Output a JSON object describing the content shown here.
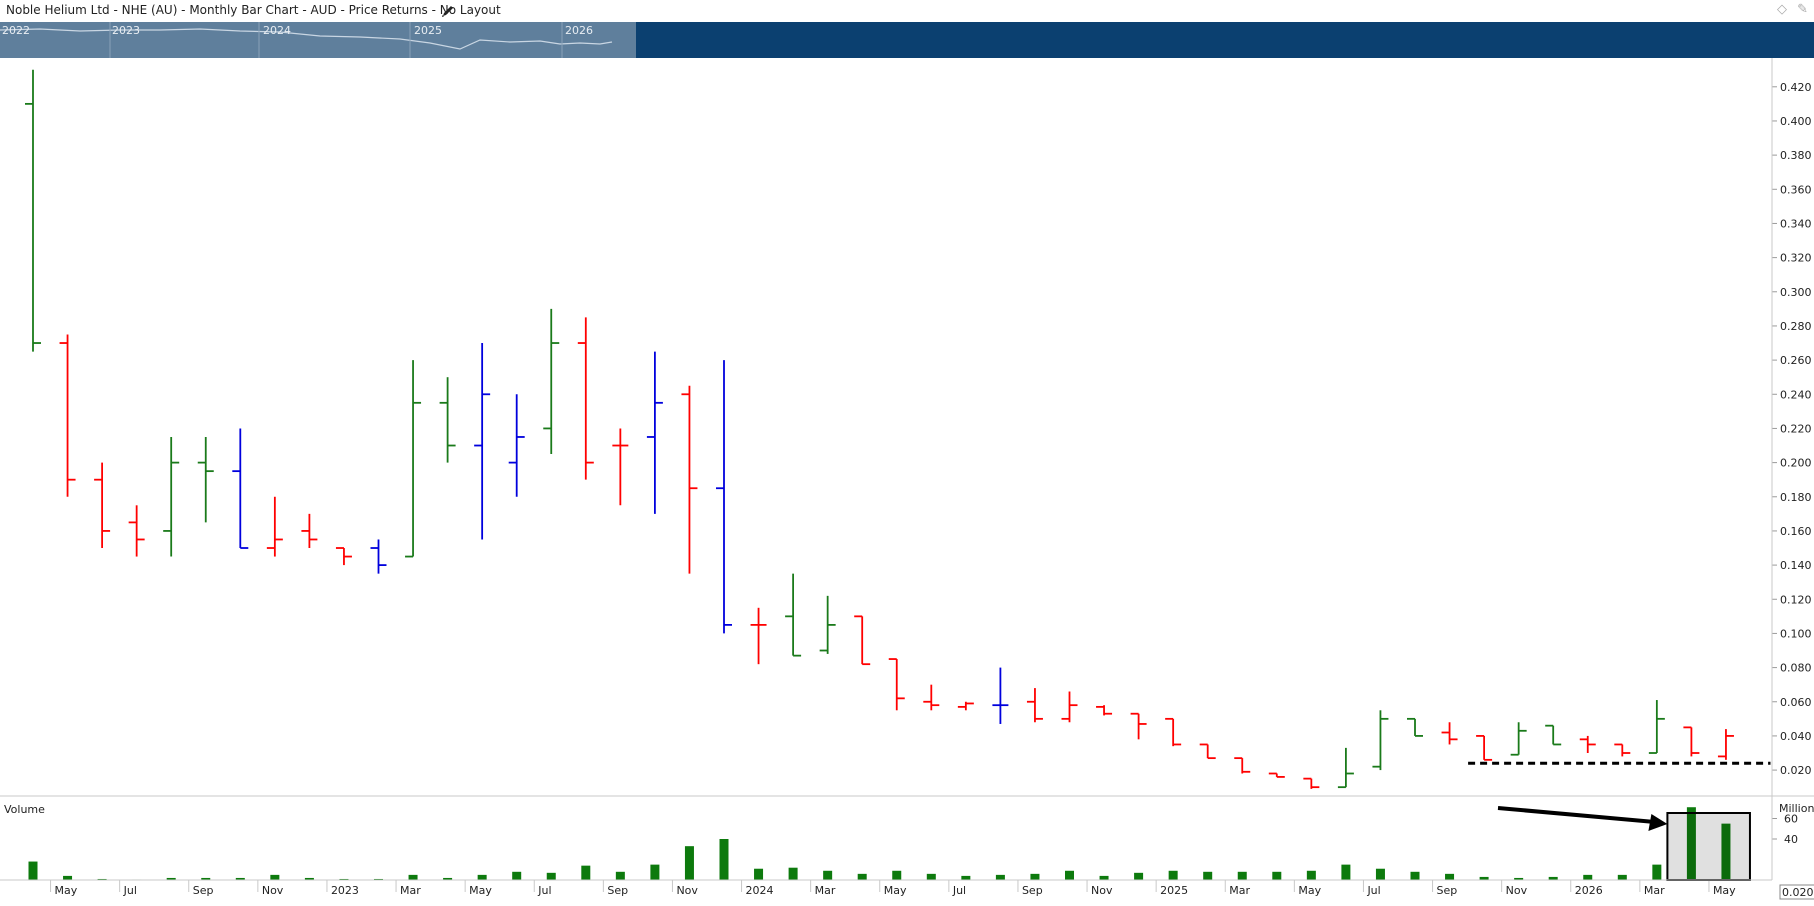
{
  "header": {
    "title": "Noble Helium Ltd - NHE (AU) - Monthly Bar Chart - AUD - Price Returns - No Layout",
    "edit_icon": "pencil-icon",
    "window_icons": [
      "diamond-icon",
      "pin-icon"
    ]
  },
  "navigator": {
    "year_labels": [
      "2022",
      "2023",
      "2024",
      "2025",
      "2026"
    ]
  },
  "colors": {
    "up": "#1a7a1a",
    "down": "#ff0000",
    "neutral": "#0000dd",
    "volume": "#0d7a0d",
    "navigator_bg": "#0b4070",
    "navigator_window": "#5f7f9c",
    "axis": "#9a9a9a"
  },
  "volume_panel": {
    "label": "Volume",
    "unit_label": "Million"
  },
  "last_value_label": "0.0202",
  "chart_data": {
    "type": "bar",
    "subtype": "ohlc",
    "title": "Noble Helium Ltd - NHE (AU) - Monthly Bar Chart - AUD - Price Returns - No Layout",
    "grid": false,
    "price_axis": {
      "position": "right",
      "ticks": [
        "0.020",
        "0.040",
        "0.060",
        "0.080",
        "0.100",
        "0.120",
        "0.140",
        "0.160",
        "0.180",
        "0.200",
        "0.220",
        "0.240",
        "0.260",
        "0.280",
        "0.300",
        "0.320",
        "0.340",
        "0.360",
        "0.380",
        "0.400",
        "0.420"
      ],
      "ylim": [
        0.006,
        0.431
      ]
    },
    "volume_axis": {
      "ticks": [
        "40",
        "60"
      ],
      "ylim": [
        0,
        80
      ]
    },
    "x_tick_labels": [
      {
        "index": 1,
        "label": "May"
      },
      {
        "index": 3,
        "label": "Jul"
      },
      {
        "index": 5,
        "label": "Sep"
      },
      {
        "index": 7,
        "label": "Nov"
      },
      {
        "index": 9,
        "label": "2023"
      },
      {
        "index": 11,
        "label": "Mar"
      },
      {
        "index": 13,
        "label": "May"
      },
      {
        "index": 15,
        "label": "Jul"
      },
      {
        "index": 17,
        "label": "Sep"
      },
      {
        "index": 19,
        "label": "Nov"
      },
      {
        "index": 21,
        "label": "2024"
      },
      {
        "index": 23,
        "label": "Mar"
      },
      {
        "index": 25,
        "label": "May"
      },
      {
        "index": 27,
        "label": "Jul"
      },
      {
        "index": 29,
        "label": "Sep"
      },
      {
        "index": 31,
        "label": "Nov"
      },
      {
        "index": 33,
        "label": "2025"
      },
      {
        "index": 35,
        "label": "Mar"
      },
      {
        "index": 37,
        "label": "May"
      },
      {
        "index": 39,
        "label": "Jul"
      },
      {
        "index": 41,
        "label": "Sep"
      },
      {
        "index": 43,
        "label": "Nov"
      },
      {
        "index": 45,
        "label": "2026"
      },
      {
        "index": 47,
        "label": "Mar"
      },
      {
        "index": 49,
        "label": "May"
      }
    ],
    "bars": [
      {
        "o": 0.41,
        "h": 0.43,
        "l": 0.265,
        "c": 0.27,
        "dir": "up",
        "v": 18
      },
      {
        "o": 0.27,
        "h": 0.275,
        "l": 0.18,
        "c": 0.19,
        "dir": "down",
        "v": 4
      },
      {
        "o": 0.19,
        "h": 0.2,
        "l": 0.15,
        "c": 0.16,
        "dir": "down",
        "v": 1
      },
      {
        "o": 0.165,
        "h": 0.175,
        "l": 0.145,
        "c": 0.155,
        "dir": "down",
        "v": 0.5
      },
      {
        "o": 0.16,
        "h": 0.215,
        "l": 0.145,
        "c": 0.2,
        "dir": "up",
        "v": 2
      },
      {
        "o": 0.2,
        "h": 0.215,
        "l": 0.165,
        "c": 0.195,
        "dir": "up",
        "v": 2
      },
      {
        "o": 0.195,
        "h": 0.22,
        "l": 0.15,
        "c": 0.15,
        "dir": "neutral",
        "v": 2
      },
      {
        "o": 0.15,
        "h": 0.18,
        "l": 0.145,
        "c": 0.155,
        "dir": "down",
        "v": 5
      },
      {
        "o": 0.16,
        "h": 0.17,
        "l": 0.15,
        "c": 0.155,
        "dir": "down",
        "v": 2
      },
      {
        "o": 0.15,
        "h": 0.15,
        "l": 0.14,
        "c": 0.145,
        "dir": "down",
        "v": 1
      },
      {
        "o": 0.15,
        "h": 0.155,
        "l": 0.135,
        "c": 0.14,
        "dir": "neutral",
        "v": 1
      },
      {
        "o": 0.145,
        "h": 0.26,
        "l": 0.145,
        "c": 0.235,
        "dir": "up",
        "v": 5
      },
      {
        "o": 0.235,
        "h": 0.25,
        "l": 0.2,
        "c": 0.21,
        "dir": "up",
        "v": 2
      },
      {
        "o": 0.21,
        "h": 0.27,
        "l": 0.155,
        "c": 0.24,
        "dir": "neutral",
        "v": 5
      },
      {
        "o": 0.2,
        "h": 0.24,
        "l": 0.18,
        "c": 0.215,
        "dir": "neutral",
        "v": 8
      },
      {
        "o": 0.22,
        "h": 0.29,
        "l": 0.205,
        "c": 0.27,
        "dir": "up",
        "v": 7
      },
      {
        "o": 0.27,
        "h": 0.285,
        "l": 0.19,
        "c": 0.2,
        "dir": "down",
        "v": 14
      },
      {
        "o": 0.21,
        "h": 0.22,
        "l": 0.175,
        "c": 0.21,
        "dir": "down",
        "v": 8
      },
      {
        "o": 0.215,
        "h": 0.265,
        "l": 0.17,
        "c": 0.235,
        "dir": "neutral",
        "v": 15
      },
      {
        "o": 0.24,
        "h": 0.245,
        "l": 0.135,
        "c": 0.185,
        "dir": "down",
        "v": 33
      },
      {
        "o": 0.185,
        "h": 0.26,
        "l": 0.1,
        "c": 0.105,
        "dir": "neutral",
        "v": 40
      },
      {
        "o": 0.105,
        "h": 0.115,
        "l": 0.082,
        "c": 0.105,
        "dir": "down",
        "v": 11
      },
      {
        "o": 0.11,
        "h": 0.135,
        "l": 0.087,
        "c": 0.087,
        "dir": "up",
        "v": 12
      },
      {
        "o": 0.09,
        "h": 0.122,
        "l": 0.088,
        "c": 0.105,
        "dir": "up",
        "v": 9
      },
      {
        "o": 0.11,
        "h": 0.11,
        "l": 0.082,
        "c": 0.082,
        "dir": "down",
        "v": 6
      },
      {
        "o": 0.085,
        "h": 0.085,
        "l": 0.055,
        "c": 0.062,
        "dir": "down",
        "v": 9
      },
      {
        "o": 0.06,
        "h": 0.07,
        "l": 0.055,
        "c": 0.058,
        "dir": "down",
        "v": 6
      },
      {
        "o": 0.057,
        "h": 0.06,
        "l": 0.055,
        "c": 0.059,
        "dir": "down",
        "v": 4
      },
      {
        "o": 0.058,
        "h": 0.08,
        "l": 0.047,
        "c": 0.058,
        "dir": "neutral",
        "v": 5
      },
      {
        "o": 0.06,
        "h": 0.068,
        "l": 0.048,
        "c": 0.05,
        "dir": "down",
        "v": 6
      },
      {
        "o": 0.05,
        "h": 0.066,
        "l": 0.048,
        "c": 0.058,
        "dir": "down",
        "v": 9
      },
      {
        "o": 0.057,
        "h": 0.058,
        "l": 0.052,
        "c": 0.053,
        "dir": "down",
        "v": 4
      },
      {
        "o": 0.053,
        "h": 0.053,
        "l": 0.038,
        "c": 0.047,
        "dir": "down",
        "v": 7
      },
      {
        "o": 0.05,
        "h": 0.05,
        "l": 0.034,
        "c": 0.035,
        "dir": "down",
        "v": 9
      },
      {
        "o": 0.035,
        "h": 0.035,
        "l": 0.027,
        "c": 0.027,
        "dir": "down",
        "v": 8
      },
      {
        "o": 0.027,
        "h": 0.027,
        "l": 0.018,
        "c": 0.019,
        "dir": "down",
        "v": 8
      },
      {
        "o": 0.018,
        "h": 0.018,
        "l": 0.016,
        "c": 0.016,
        "dir": "down",
        "v": 8
      },
      {
        "o": 0.015,
        "h": 0.015,
        "l": 0.009,
        "c": 0.01,
        "dir": "down",
        "v": 9
      },
      {
        "o": 0.01,
        "h": 0.033,
        "l": 0.01,
        "c": 0.018,
        "dir": "up",
        "v": 15
      },
      {
        "o": 0.022,
        "h": 0.055,
        "l": 0.02,
        "c": 0.05,
        "dir": "up",
        "v": 11
      },
      {
        "o": 0.05,
        "h": 0.05,
        "l": 0.04,
        "c": 0.04,
        "dir": "up",
        "v": 8
      },
      {
        "o": 0.042,
        "h": 0.048,
        "l": 0.035,
        "c": 0.038,
        "dir": "down",
        "v": 6
      },
      {
        "o": 0.04,
        "h": 0.04,
        "l": 0.026,
        "c": 0.026,
        "dir": "down",
        "v": 3
      },
      {
        "o": 0.029,
        "h": 0.048,
        "l": 0.029,
        "c": 0.043,
        "dir": "up",
        "v": 2
      },
      {
        "o": 0.046,
        "h": 0.046,
        "l": 0.035,
        "c": 0.035,
        "dir": "up",
        "v": 3
      },
      {
        "o": 0.038,
        "h": 0.04,
        "l": 0.03,
        "c": 0.035,
        "dir": "down",
        "v": 5
      },
      {
        "o": 0.035,
        "h": 0.035,
        "l": 0.028,
        "c": 0.03,
        "dir": "down",
        "v": 5
      },
      {
        "o": 0.03,
        "h": 0.061,
        "l": 0.03,
        "c": 0.05,
        "dir": "up",
        "v": 15
      },
      {
        "o": 0.045,
        "h": 0.045,
        "l": 0.028,
        "c": 0.03,
        "dir": "down",
        "v": 71
      },
      {
        "o": 0.028,
        "h": 0.044,
        "l": 0.026,
        "c": 0.04,
        "dir": "down",
        "v": 55
      }
    ],
    "annotations": {
      "support_line_level": 0.024,
      "highlight_box_bar_indices": [
        48,
        49
      ]
    }
  }
}
